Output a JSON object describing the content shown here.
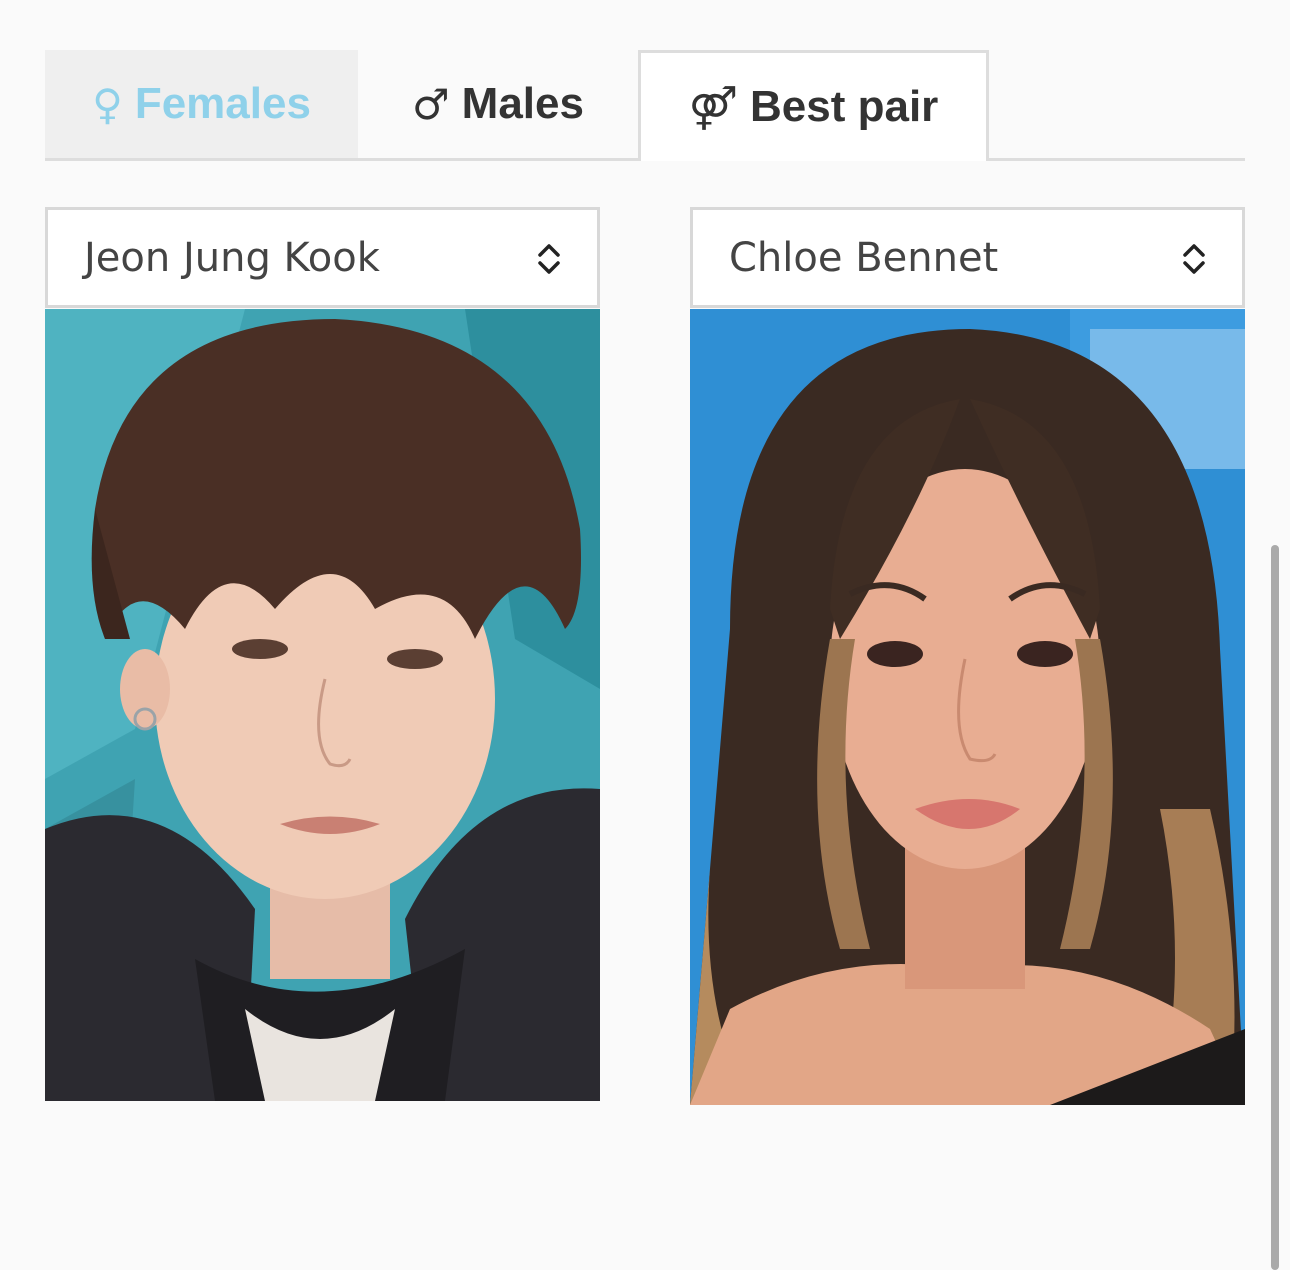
{
  "tabs": [
    {
      "symbol": "♀",
      "label": "Females"
    },
    {
      "symbol": "♂",
      "label": "Males"
    },
    {
      "symbol": "⚤",
      "label": "Best pair"
    }
  ],
  "active_tab": "Best pair",
  "left_select": {
    "value": "Jeon Jung Kook"
  },
  "right_select": {
    "value": "Chloe Bennet"
  },
  "colors": {
    "females_accent": "#8fd1ea",
    "left_photo_background": "#3fa3b2",
    "right_photo_background": "#2f8fd4"
  }
}
